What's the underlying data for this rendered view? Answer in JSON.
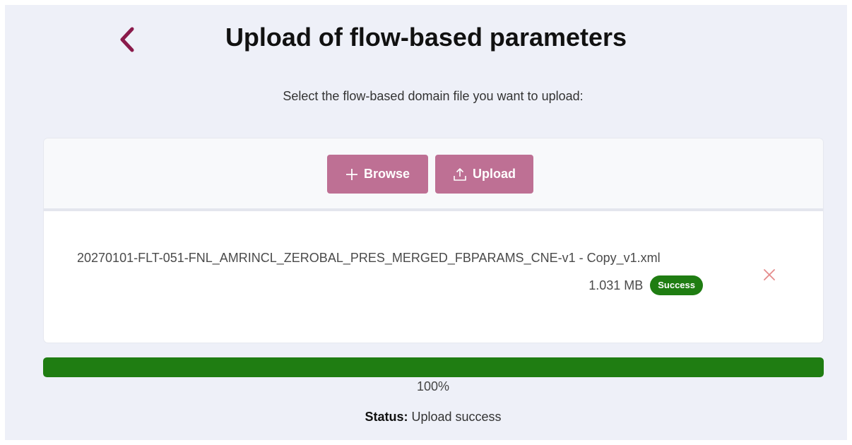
{
  "header": {
    "title": "Upload of flow-based parameters",
    "back_icon": "chevron-left-icon",
    "accent_color": "#8a1a4b"
  },
  "instructions": "Select the flow-based domain file you want to upload:",
  "toolbar": {
    "browse_label": "Browse",
    "browse_icon": "plus-icon",
    "upload_label": "Upload",
    "upload_icon": "upload-icon",
    "button_color": "#be7094"
  },
  "file": {
    "name": "20270101-FLT-051-FNL_AMRINCL_ZEROBAL_PRES_MERGED_FBPARAMS_CNE-v1 - Copy_v1.xml",
    "size": "1.031 MB",
    "badge": "Success",
    "badge_color": "#1f7d12",
    "remove_icon": "close-icon"
  },
  "progress": {
    "percent": 100,
    "label": "100%",
    "color": "#1f7d12"
  },
  "status": {
    "key": "Status:",
    "value": "Upload success"
  }
}
